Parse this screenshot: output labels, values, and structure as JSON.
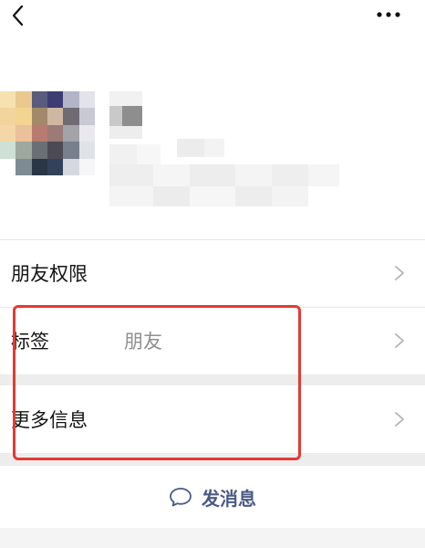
{
  "header": {
    "back_icon": "chevron-left-icon",
    "more_icon": "more-horizontal-icon"
  },
  "profile": {
    "avatar_note": "pixelated",
    "avatar_colors": [
      "#f6e2b0",
      "#e9c98f",
      "#5b5b7d",
      "#3b3d73",
      "#b4b4c9",
      "#e2e3eb",
      "#f2d59c",
      "#f3d58f",
      "#a3896b",
      "#cfb7a1",
      "#6f6b74",
      "#c9c9d6",
      "#f3d7a6",
      "#eac19a",
      "#b77b6f",
      "#9c7a76",
      "#a3a3aa",
      "#e8e8ee",
      "#cfe0d6",
      "#9fa89e",
      "#6a6f73",
      "#4c4a55",
      "#77808c",
      "#dfe3e8",
      "#ffffff",
      "#7f8b92",
      "#2a3645",
      "#33425a",
      "#d5d9df",
      "#f6f6f8"
    ]
  },
  "rows": {
    "permissions": {
      "label": "朋友权限"
    },
    "tags": {
      "label": "标签",
      "value": "朋友"
    },
    "more_info": {
      "label": "更多信息"
    }
  },
  "actions": {
    "message_label": "发消息",
    "message_icon": "chat-bubble-icon"
  },
  "colors": {
    "highlight_border": "#e53935",
    "message_text": "#4a5a86",
    "secondary_text": "#8f8f8f"
  }
}
